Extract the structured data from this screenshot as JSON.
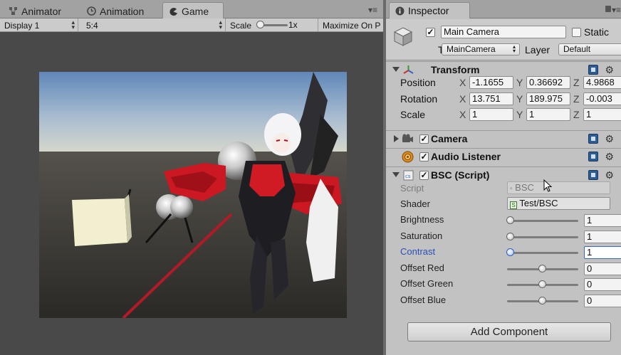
{
  "editor_tabs": [
    {
      "label": "Animator",
      "icon": "animator-icon"
    },
    {
      "label": "Animation",
      "icon": "animation-clock-icon"
    },
    {
      "label": "Game",
      "icon": "game-pacman-icon",
      "active": true
    }
  ],
  "game_toolbar": {
    "display": "Display 1",
    "aspect": "5:4",
    "scale_label": "Scale",
    "scale_value": "1x",
    "maximize": "Maximize On P"
  },
  "inspector": {
    "tab_label": "Inspector",
    "object": {
      "name": "Main Camera",
      "static_label": "Static",
      "tag_label": "Tag",
      "tag_value": "MainCamera",
      "layer_label": "Layer",
      "layer_value": "Default"
    },
    "transform": {
      "title": "Transform",
      "position": {
        "label": "Position",
        "x": "-1.1655",
        "y": "0.36692",
        "z": "4.9868"
      },
      "rotation": {
        "label": "Rotation",
        "x": "13.751",
        "y": "189.975",
        "z": "-0.003"
      },
      "scale": {
        "label": "Scale",
        "x": "1",
        "y": "1",
        "z": "1"
      },
      "axis_x": "X",
      "axis_y": "Y",
      "axis_z": "Z"
    },
    "components": {
      "camera": "Camera",
      "audio_listener": "Audio Listener",
      "bsc": "BSC (Script)"
    },
    "bsc": {
      "script_label": "Script",
      "script_value": "BSC",
      "shader_label": "Shader",
      "shader_value": "Test/BSC",
      "params": [
        {
          "label": "Brightness",
          "value": "1",
          "level": 0.05
        },
        {
          "label": "Saturation",
          "value": "1",
          "level": 0.05
        },
        {
          "label": "Contrast",
          "value": "1",
          "level": 0.05,
          "focused": true
        },
        {
          "label": "Offset Red",
          "value": "0",
          "level": 0.5
        },
        {
          "label": "Offset Green",
          "value": "0",
          "level": 0.5
        },
        {
          "label": "Offset Blue",
          "value": "0",
          "level": 0.5
        }
      ]
    },
    "add_component": "Add Component"
  }
}
